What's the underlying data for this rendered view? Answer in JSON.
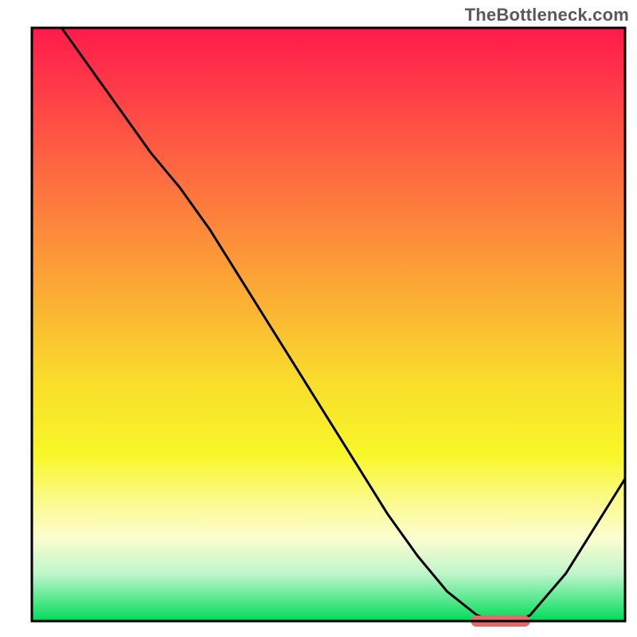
{
  "attribution": "TheBottleneck.com",
  "chart_data": {
    "type": "line",
    "title": "",
    "xlabel": "",
    "ylabel": "",
    "xlim": [
      0,
      100
    ],
    "ylim": [
      0,
      100
    ],
    "series": [
      {
        "name": "curve",
        "x": [
          5,
          10,
          15,
          20,
          25,
          30,
          35,
          40,
          45,
          50,
          55,
          60,
          65,
          70,
          75,
          78,
          80,
          82,
          84,
          90,
          95,
          100
        ],
        "y": [
          100,
          93,
          86,
          79,
          73,
          66,
          58,
          50,
          42,
          34,
          26,
          18,
          11,
          5,
          1,
          0,
          0,
          0,
          1,
          8,
          16,
          24
        ]
      }
    ],
    "optimum_band": {
      "x_start": 74,
      "x_end": 84
    },
    "gradient_stops": [
      {
        "offset": 0.0,
        "color": "#ff1b4b"
      },
      {
        "offset": 0.05,
        "color": "#ff2a4a"
      },
      {
        "offset": 0.15,
        "color": "#ff4b45"
      },
      {
        "offset": 0.3,
        "color": "#fd7c3d"
      },
      {
        "offset": 0.45,
        "color": "#fbad34"
      },
      {
        "offset": 0.6,
        "color": "#f9de2b"
      },
      {
        "offset": 0.72,
        "color": "#f8f728"
      },
      {
        "offset": 0.8,
        "color": "#fbfa8f"
      },
      {
        "offset": 0.86,
        "color": "#fdfdd0"
      },
      {
        "offset": 0.92,
        "color": "#c0f5cb"
      },
      {
        "offset": 0.96,
        "color": "#60e993"
      },
      {
        "offset": 1.0,
        "color": "#00db59"
      }
    ],
    "colors": {
      "border": "#000000",
      "line": "#000000",
      "marker": "#e26a6a"
    }
  }
}
